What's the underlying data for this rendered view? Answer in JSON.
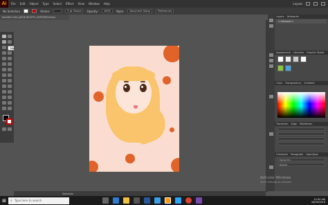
{
  "app": {
    "logo": "Ai"
  },
  "menubar": {
    "items": [
      "File",
      "Edit",
      "Object",
      "Type",
      "Select",
      "Effect",
      "View",
      "Window",
      "Help"
    ],
    "workspace": "Layout"
  },
  "control_bar": {
    "selection_label": "No Selection",
    "stroke_label": "Stroke:",
    "brush": "5 pt. Round",
    "opacity_label": "Opacity:",
    "opacity_value": "100%",
    "style_label": "Style:",
    "doc_setup": "Document Setup",
    "preferences": "Preferences"
  },
  "document_tab": {
    "title": "kandikhi hd4.pdf @ 66.67% (CMYK/Preview)"
  },
  "tooltip": {
    "text": "Magic Wand Tool (Y)"
  },
  "canvas": {
    "artboard_bg": "#fbdcd1",
    "accent_dots": "#e0632a",
    "hijab_color": "#f9c46b"
  },
  "panels": {
    "artboards": {
      "tabs": [
        "Layers",
        "Artboards"
      ],
      "rows": [
        "1   Artboard 1"
      ]
    },
    "appearance": {
      "tabs": [
        "Appearance",
        "Libraries",
        "Graphic Styles"
      ]
    },
    "color": {
      "tabs": [
        "Color",
        "Transparency",
        "Gradient"
      ]
    },
    "transform": {
      "tabs": [
        "Transform",
        "Align",
        "Pathfinder"
      ]
    },
    "character": {
      "tabs": [
        "Character",
        "Paragraph",
        "OpenType"
      ],
      "font": "Myriad Pro",
      "style": "Regular"
    }
  },
  "status": {
    "zoom": "66.67%",
    "tool": "Selection"
  },
  "taskbar": {
    "search_placeholder": "Type here to search",
    "time": "12:50 AM",
    "date": "18/09/2019"
  },
  "watermark": {
    "line1": "Activate Windows",
    "line2": "Go to Settings to activate"
  }
}
